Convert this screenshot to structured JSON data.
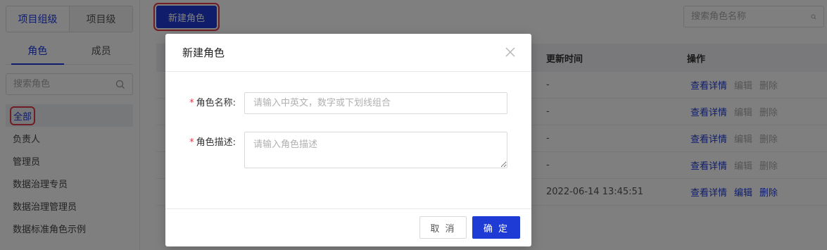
{
  "sidebar": {
    "segments": [
      "项目组级",
      "项目级"
    ],
    "tabs": [
      "角色",
      "成员"
    ],
    "search_placeholder": "搜索角色",
    "roles": [
      "全部",
      "负责人",
      "管理员",
      "数据治理专员",
      "数据治理管理员",
      "数据标准角色示例"
    ]
  },
  "main": {
    "new_role_button": "新建角色",
    "search_placeholder": "搜索角色名称",
    "table": {
      "header_update_time": "更新时间",
      "header_actions": "操作",
      "rows": [
        {
          "update_time": "-"
        },
        {
          "update_time": "-"
        },
        {
          "update_time": "-"
        },
        {
          "update_time": "-"
        },
        {
          "update_time": "2022-06-14 13:45:51"
        }
      ],
      "action_view": "查看详情",
      "action_edit": "编辑",
      "action_delete": "删除"
    }
  },
  "modal": {
    "title": "新建角色",
    "name_label": "角色名称:",
    "name_placeholder": "请输入中英文，数字或下划线组合",
    "desc_label": "角色描述:",
    "desc_placeholder": "请输入角色描述",
    "cancel_label": "取 消",
    "ok_label": "确 定"
  },
  "colors": {
    "primary": "#1e3bd6",
    "highlight": "#e23b4b"
  }
}
